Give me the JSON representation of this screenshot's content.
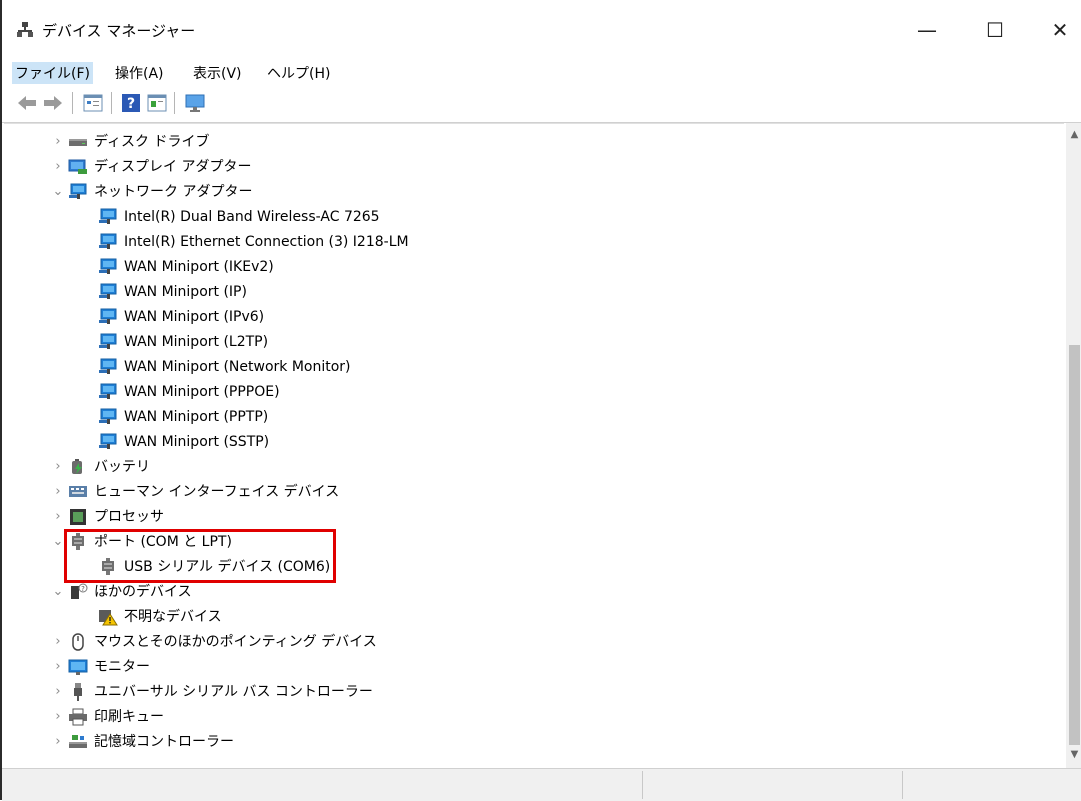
{
  "window": {
    "title": "デバイス マネージャー",
    "minimize_glyph": "—",
    "maximize_glyph": "☐",
    "close_glyph": "✕"
  },
  "menu": [
    {
      "key": "file",
      "label": "ファイル(F)"
    },
    {
      "key": "action",
      "label": "操作(A)"
    },
    {
      "key": "view",
      "label": "表示(V)"
    },
    {
      "key": "help",
      "label": "ヘルプ(H)"
    }
  ],
  "toolbar": [
    "back-icon",
    "forward-icon",
    "properties-icon",
    "help-icon",
    "view-icon",
    "monitor-icon"
  ],
  "tree": {
    "disk_drives": "ディスク ドライブ",
    "display_adapters": "ディスプレイ アダプター",
    "network_adapters": "ネットワーク アダプター",
    "network_children": [
      "Intel(R) Dual Band Wireless-AC 7265",
      "Intel(R) Ethernet Connection (3) I218-LM",
      "WAN Miniport (IKEv2)",
      "WAN Miniport (IP)",
      "WAN Miniport (IPv6)",
      "WAN Miniport (L2TP)",
      "WAN Miniport (Network Monitor)",
      "WAN Miniport (PPPOE)",
      "WAN Miniport (PPTP)",
      "WAN Miniport (SSTP)"
    ],
    "battery": "バッテリ",
    "hid": "ヒューマン インターフェイス デバイス",
    "processor": "プロセッサ",
    "ports": "ポート (COM と LPT)",
    "usb_serial": "USB シリアル デバイス (COM6)",
    "other_devices": "ほかのデバイス",
    "unknown_device": "不明なデバイス",
    "mice": "マウスとそのほかのポインティング デバイス",
    "monitors": "モニター",
    "usb_controllers": "ユニバーサル シリアル バス コントローラー",
    "print_queues": "印刷キュー",
    "storage_controllers": "記憶域コントローラー"
  },
  "colors": {
    "highlight_border": "#e00000",
    "menu_selected": "#cce4f7"
  }
}
